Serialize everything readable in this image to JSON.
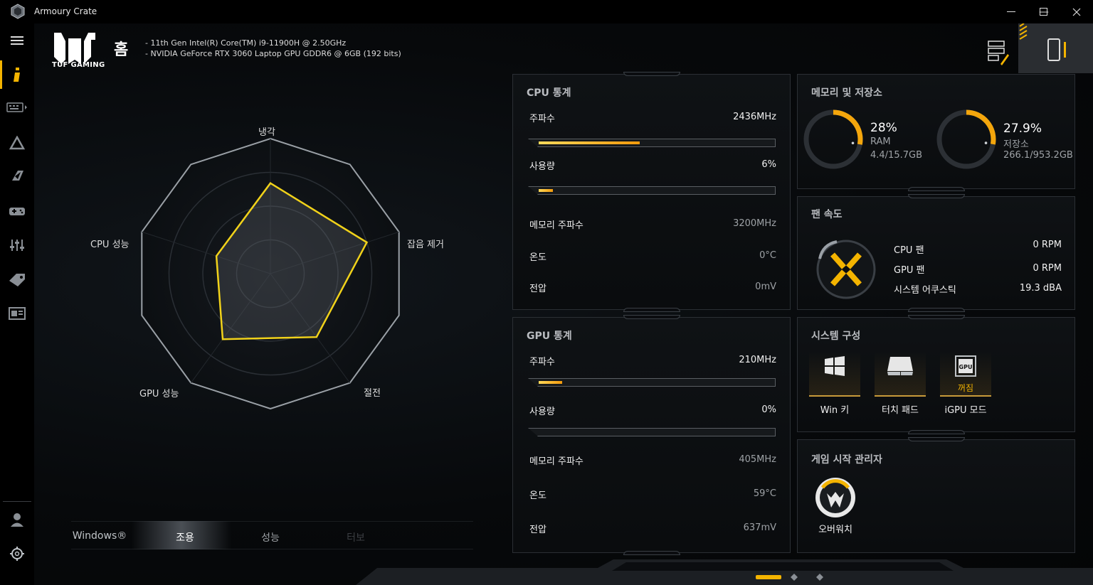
{
  "window": {
    "title": "Armoury Crate",
    "minimize": "—",
    "maximize": "☐",
    "close": "✕"
  },
  "sidebar": {
    "items": [
      {
        "name": "menu-icon"
      },
      {
        "name": "home-info-icon",
        "active": true
      },
      {
        "name": "keyboard-device-icon"
      },
      {
        "name": "aura-triangle-icon"
      },
      {
        "name": "scenario-icon"
      },
      {
        "name": "gamepad-icon"
      },
      {
        "name": "settings-sliders-icon"
      },
      {
        "name": "deals-tag-icon"
      },
      {
        "name": "news-icon"
      },
      {
        "name": "user-icon"
      },
      {
        "name": "gear-icon"
      }
    ]
  },
  "header": {
    "brand": "TUF GAMING",
    "title": "홈",
    "specs": [
      "-   11th Gen Intel(R) Core(TM) i9-11900H @ 2.50GHz",
      "-   NVIDIA GeForce RTX 3060 Laptop GPU GDDR6 @ 6GB (192 bits)"
    ]
  },
  "radar": {
    "labels": {
      "top": "냉각",
      "right": "잡음 제거",
      "bottom_right": "절전",
      "bottom_left": "GPU 성능",
      "left": "CPU 성능"
    },
    "values": {
      "top": 0.67,
      "right": 0.75,
      "bottom_right": 0.58,
      "bottom_left": 0.6,
      "left": 0.42
    }
  },
  "modes": {
    "items": [
      "Windows®",
      "조용",
      "성능",
      "터보"
    ],
    "selected": "조용"
  },
  "cpu": {
    "title": "CPU 통계",
    "freq_label": "주파수",
    "freq_value": "2436MHz",
    "freq_fill": 0.43,
    "usage_label": "사용량",
    "usage_value": "6%",
    "usage_fill": 0.06,
    "mem_label": "메모리 주파수",
    "mem_value": "3200MHz",
    "temp_label": "온도",
    "temp_value": "0°C",
    "volt_label": "전압",
    "volt_value": "0mV"
  },
  "gpu": {
    "title": "GPU 통계",
    "freq_label": "주파수",
    "freq_value": "210MHz",
    "freq_fill": 0.1,
    "usage_label": "사용량",
    "usage_value": "0%",
    "usage_fill": 0.0,
    "mem_label": "메모리 주파수",
    "mem_value": "405MHz",
    "temp_label": "온도",
    "temp_value": "59°C",
    "volt_label": "전압",
    "volt_value": "637mV"
  },
  "memory": {
    "title": "메모리 및 저장소",
    "ram": {
      "percent": "28%",
      "label": "RAM",
      "detail": "4.4/15.7GB",
      "fill": 0.28
    },
    "storage": {
      "percent": "27.9%",
      "label": "저장소",
      "detail": "266.1/953.2GB",
      "fill": 0.279
    }
  },
  "fan": {
    "title": "팬 속도",
    "rows": [
      {
        "label": "CPU 팬",
        "value": "0 RPM"
      },
      {
        "label": "GPU 팬",
        "value": "0 RPM"
      },
      {
        "label": "시스템 어쿠스틱",
        "value": "19.3  dBA"
      }
    ]
  },
  "system_config": {
    "title": "시스템 구성",
    "items": [
      {
        "label": "Win 키"
      },
      {
        "label": "터치 패드"
      },
      {
        "label": "iGPU 모드",
        "state": "꺼짐"
      }
    ]
  },
  "game_launcher": {
    "title": "게임 시작 관리자",
    "games": [
      {
        "label": "오버워치"
      }
    ]
  },
  "colors": {
    "accent": "#f4b400",
    "radar_line": "#f1d21a",
    "bar_fill": "#f29a0c"
  }
}
